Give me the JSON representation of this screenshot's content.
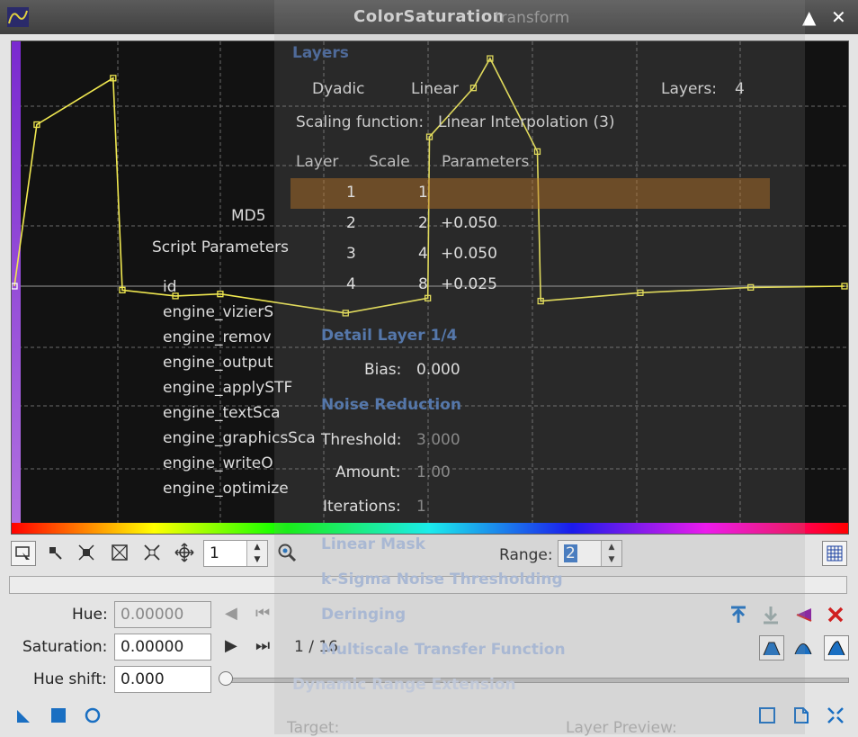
{
  "window": {
    "title": "ColorSaturation"
  },
  "toolbar": {
    "zoom_value": "1",
    "range_label": "Range:",
    "range_value": "2"
  },
  "controls": {
    "hue_label": "Hue:",
    "hue_value": "0.00000",
    "saturation_label": "Saturation:",
    "saturation_value": "0.00000",
    "hue_shift_label": "Hue shift:",
    "hue_shift_value": "0.000",
    "point_counter": "1 / 16"
  },
  "background_dialog": {
    "transform": "transform",
    "layers_header": "Layers",
    "dyadic": "Dyadic",
    "linear": "Linear",
    "layers_label": "Layers:",
    "layers_value": "4",
    "scaling_label": "Scaling function:",
    "scaling_value": "Linear Interpolation (3)",
    "table_headers": [
      "Layer",
      "Scale",
      "Parameters"
    ],
    "table_rows": [
      {
        "layer": "1",
        "scale": "1",
        "params": ""
      },
      {
        "layer": "2",
        "scale": "2",
        "params": "+0.050"
      },
      {
        "layer": "3",
        "scale": "4",
        "params": "+0.050"
      },
      {
        "layer": "4",
        "scale": "8",
        "params": "+0.025"
      }
    ],
    "detail_layer": "Detail Layer 1/4",
    "bias_label": "Bias:",
    "bias_value": "0.000",
    "noise_reduction": "Noise Reduction",
    "threshold_label": "Threshold:",
    "threshold_value": "3.000",
    "amount_label": "Amount:",
    "amount_value": "1.00",
    "iterations_label": "Iterations:",
    "iterations_value": "1",
    "linear_mask": "Linear Mask",
    "ksigma": "k-Sigma Noise Thresholding",
    "deringing": "Deringing",
    "mst_function": "Multiscale Transfer Function",
    "dre": "Dynamic Range Extension",
    "target_label": "Target:",
    "layer_preview_label": "Layer Preview:",
    "script_params": "Script Parameters",
    "md5": "MD5",
    "script_list": [
      "id",
      "engine_vizierS",
      "engine_remov",
      "engine_output",
      "engine_applySTF",
      "engine_textSca",
      "engine_graphicsSca",
      "engine_writeO",
      "engine_optimize"
    ]
  },
  "colors": {
    "curve": "#f0e850",
    "curve_bg": "#121212",
    "accent": "#1a6fc2",
    "delete": "#d02020"
  },
  "curve_points": [
    {
      "hue": 0.0,
      "sat": 0.0
    },
    {
      "hue": 0.027,
      "sat": 0.66
    },
    {
      "hue": 0.119,
      "sat": 0.85
    },
    {
      "hue": 0.13,
      "sat": -0.016
    },
    {
      "hue": 0.194,
      "sat": -0.04
    },
    {
      "hue": 0.248,
      "sat": -0.032
    },
    {
      "hue": 0.399,
      "sat": -0.11
    },
    {
      "hue": 0.498,
      "sat": -0.049
    },
    {
      "hue": 0.5,
      "sat": 0.61
    },
    {
      "hue": 0.553,
      "sat": 0.81
    },
    {
      "hue": 0.573,
      "sat": 0.93
    },
    {
      "hue": 0.63,
      "sat": 0.55
    },
    {
      "hue": 0.634,
      "sat": -0.061
    },
    {
      "hue": 0.754,
      "sat": -0.027
    },
    {
      "hue": 0.887,
      "sat": -0.005
    },
    {
      "hue": 1.0,
      "sat": 0.0
    }
  ]
}
